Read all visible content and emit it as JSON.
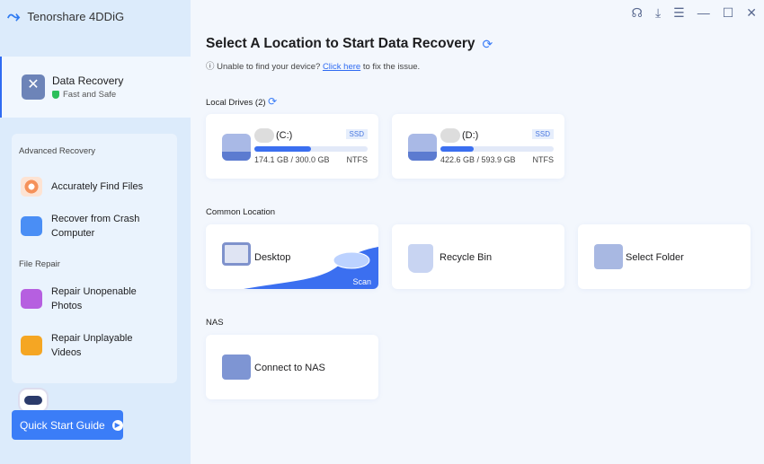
{
  "app": {
    "title": "Tenorshare 4DDiG"
  },
  "sidebar": {
    "data_recovery": {
      "title": "Data Recovery",
      "subtitle": "Fast and Safe"
    },
    "advanced_label": "Advanced Recovery",
    "advanced_items": [
      {
        "label": "Accurately Find Files"
      },
      {
        "label": "Recover from Crash Computer"
      }
    ],
    "repair_label": "File Repair",
    "repair_items": [
      {
        "label": "Repair Unopenable Photos"
      },
      {
        "label": "Repair Unplayable Videos"
      }
    ],
    "quick_start": "Quick Start Guide"
  },
  "main": {
    "title": "Select A Location to Start Data Recovery",
    "hint_prefix": "Unable to find your device?",
    "hint_link": "Click here",
    "hint_suffix": "to fix the issue.",
    "local_drives_label": "Local Drives (2)",
    "drives": [
      {
        "name": "(C:)",
        "type": "SSD",
        "size": "174.1 GB / 300.0 GB",
        "fs": "NTFS",
        "fill": 0.5
      },
      {
        "name": "(D:)",
        "type": "SSD",
        "size": "422.6 GB / 593.9 GB",
        "fs": "NTFS",
        "fill": 0.29
      }
    ],
    "common_label": "Common Location",
    "common": [
      {
        "label": "Desktop",
        "action": "Scan"
      },
      {
        "label": "Recycle Bin"
      },
      {
        "label": "Select Folder"
      }
    ],
    "nas_label": "NAS",
    "nas": {
      "label": "Connect to NAS"
    }
  },
  "colors": {
    "accent": "#3b7df7",
    "sidebar": "#dcebfb"
  }
}
